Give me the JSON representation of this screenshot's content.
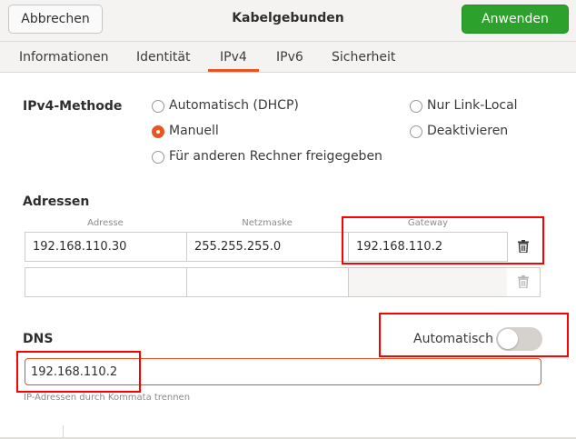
{
  "header": {
    "cancel_label": "Abbrechen",
    "title": "Kabelgebunden",
    "apply_label": "Anwenden"
  },
  "tabs": [
    {
      "label": "Informationen"
    },
    {
      "label": "Identität"
    },
    {
      "label": "IPv4",
      "active": true
    },
    {
      "label": "IPv6"
    },
    {
      "label": "Sicherheit"
    }
  ],
  "ipv4": {
    "method_label": "IPv4-Methode",
    "methods": [
      {
        "label": "Automatisch (DHCP)",
        "checked": false
      },
      {
        "label": "Manuell",
        "checked": true
      },
      {
        "label": "Für anderen Rechner freigegeben",
        "checked": false
      },
      {
        "label": "Nur Link-Local",
        "checked": false
      },
      {
        "label": "Deaktivieren",
        "checked": false
      }
    ]
  },
  "addresses": {
    "section_label": "Adressen",
    "columns": [
      "Adresse",
      "Netzmaske",
      "Gateway"
    ],
    "rows": [
      {
        "address": "192.168.110.30",
        "netmask": "255.255.255.0",
        "gateway": "192.168.110.2"
      },
      {
        "address": "",
        "netmask": "",
        "gateway": ""
      }
    ]
  },
  "dns": {
    "section_label": "DNS",
    "auto_label": "Automatisch",
    "auto_enabled": false,
    "value": "192.168.110.2",
    "hint": "IP-Adressen durch Kommata trennen"
  },
  "colors": {
    "accent": "#e95420",
    "apply_button": "#2ca22c",
    "highlight_box": "#ff0000"
  },
  "icons": {
    "row_delete": "trash-icon"
  }
}
